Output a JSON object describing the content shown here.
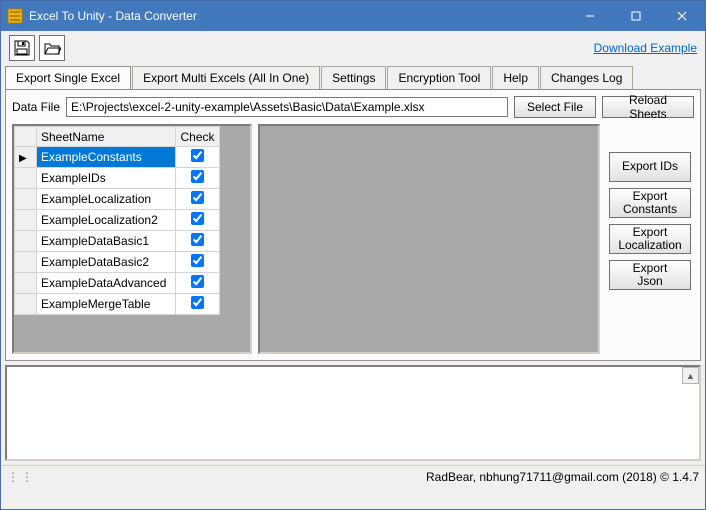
{
  "window": {
    "title": "Excel To Unity - Data Converter"
  },
  "toolbar": {
    "download_link": "Download Example"
  },
  "tabs": [
    {
      "label": "Export Single Excel",
      "active": true
    },
    {
      "label": "Export Multi Excels (All In One)"
    },
    {
      "label": "Settings"
    },
    {
      "label": "Encryption Tool"
    },
    {
      "label": "Help"
    },
    {
      "label": "Changes Log"
    }
  ],
  "datafile": {
    "label": "Data File",
    "value": "E:\\Projects\\excel-2-unity-example\\Assets\\Basic\\Data\\Example.xlsx",
    "select_button": "Select File",
    "reload_button": "Reload Sheets"
  },
  "grid": {
    "columns": {
      "name": "SheetName",
      "check": "Check"
    },
    "rows": [
      {
        "name": "ExampleConstants",
        "checked": true,
        "selected": true
      },
      {
        "name": "ExampleIDs",
        "checked": true
      },
      {
        "name": "ExampleLocalization",
        "checked": true
      },
      {
        "name": "ExampleLocalization2",
        "checked": true
      },
      {
        "name": "ExampleDataBasic1",
        "checked": true
      },
      {
        "name": "ExampleDataBasic2",
        "checked": true
      },
      {
        "name": "ExampleDataAdvanced",
        "checked": true
      },
      {
        "name": "ExampleMergeTable",
        "checked": true
      }
    ]
  },
  "side_buttons": {
    "export_ids": "Export IDs",
    "export_constants": "Export\nConstants",
    "export_localization": "Export\nLocalization",
    "export_json": "Export Json"
  },
  "status": {
    "text": "RadBear, nbhung71711@gmail.com (2018) ©  1.4.7"
  }
}
